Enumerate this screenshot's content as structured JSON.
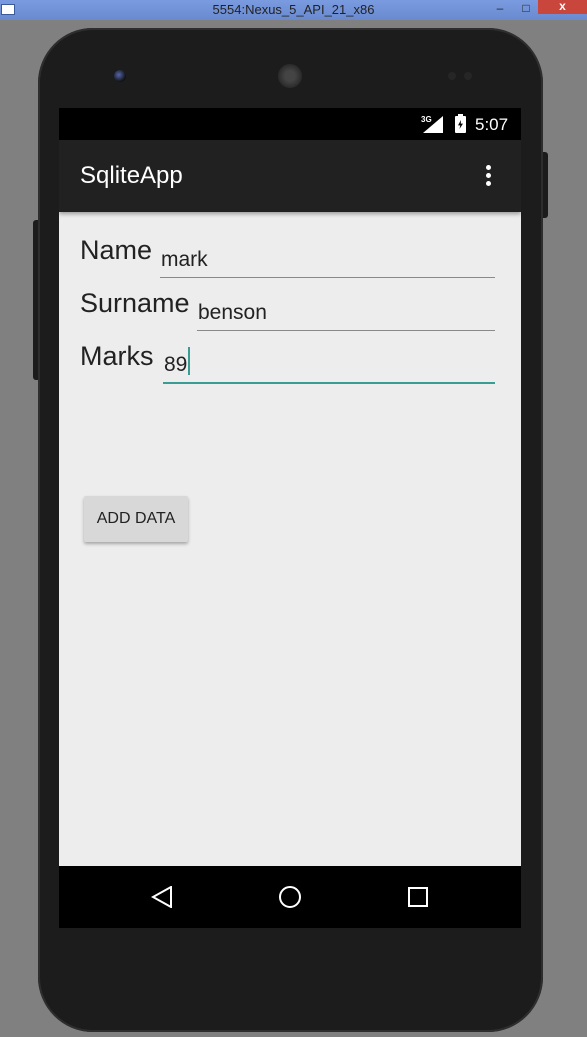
{
  "window": {
    "title": "5554:Nexus_5_API_21_x86",
    "minimize": "–",
    "maximize": "□",
    "close": "x"
  },
  "status": {
    "network": "3G",
    "time": "5:07"
  },
  "appbar": {
    "title": "SqliteApp"
  },
  "form": {
    "name_label": "Name",
    "name_value": "mark",
    "surname_label": "Surname",
    "surname_value": "benson",
    "marks_label": "Marks",
    "marks_value": "89"
  },
  "buttons": {
    "add_data": "ADD DATA"
  },
  "colors": {
    "accent": "#3a9d93",
    "appbar": "#212121",
    "background": "#ededed"
  }
}
